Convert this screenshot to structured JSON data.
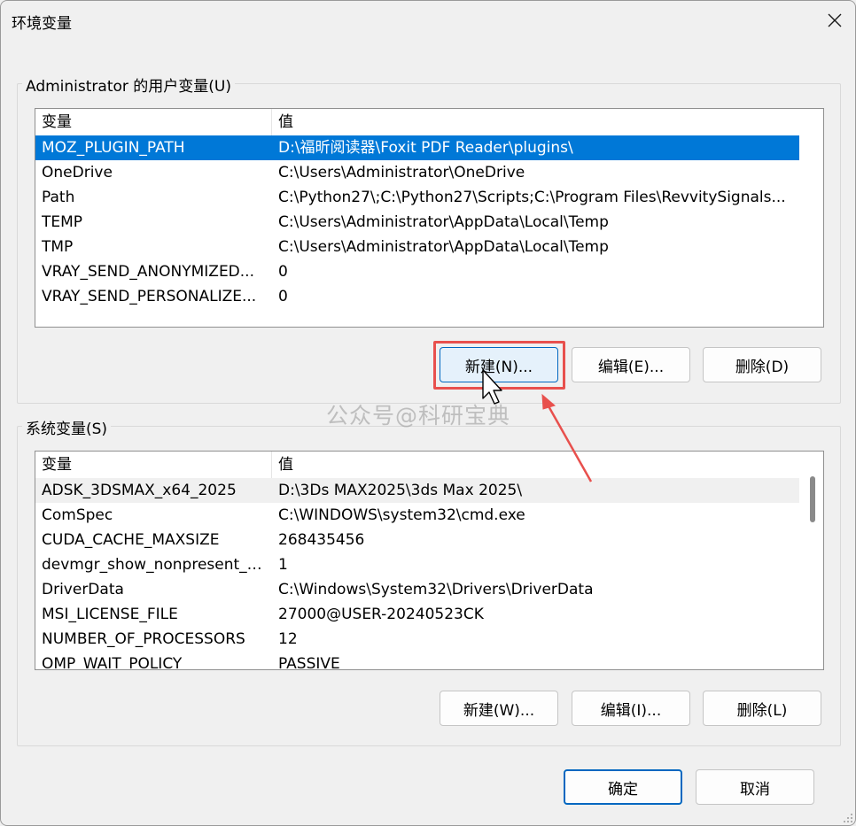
{
  "window": {
    "title": "环境变量"
  },
  "user_vars": {
    "legend": "Administrator 的用户变量(U)",
    "col_var": "变量",
    "col_val": "值",
    "rows": [
      {
        "name": "MOZ_PLUGIN_PATH",
        "value": "D:\\福昕阅读器\\Foxit PDF Reader\\plugins\\"
      },
      {
        "name": "OneDrive",
        "value": "C:\\Users\\Administrator\\OneDrive"
      },
      {
        "name": "Path",
        "value": "C:\\Python27\\;C:\\Python27\\Scripts;C:\\Program Files\\RevvitySignals..."
      },
      {
        "name": "TEMP",
        "value": "C:\\Users\\Administrator\\AppData\\Local\\Temp"
      },
      {
        "name": "TMP",
        "value": "C:\\Users\\Administrator\\AppData\\Local\\Temp"
      },
      {
        "name": "VRAY_SEND_ANONYMIZED...",
        "value": "0"
      },
      {
        "name": "VRAY_SEND_PERSONALIZE...",
        "value": "0"
      }
    ],
    "new_label": "新建(N)...",
    "edit_label": "编辑(E)...",
    "delete_label": "删除(D)"
  },
  "system_vars": {
    "legend": "系统变量(S)",
    "col_var": "变量",
    "col_val": "值",
    "rows": [
      {
        "name": "ADSK_3DSMAX_x64_2025",
        "value": "D:\\3Ds MAX2025\\3ds Max 2025\\"
      },
      {
        "name": "ComSpec",
        "value": "C:\\WINDOWS\\system32\\cmd.exe"
      },
      {
        "name": "CUDA_CACHE_MAXSIZE",
        "value": "268435456"
      },
      {
        "name": "devmgr_show_nonpresent_d...",
        "value": "1"
      },
      {
        "name": "DriverData",
        "value": "C:\\Windows\\System32\\Drivers\\DriverData"
      },
      {
        "name": "MSI_LICENSE_FILE",
        "value": "27000@USER-20240523CK"
      },
      {
        "name": "NUMBER_OF_PROCESSORS",
        "value": "12"
      },
      {
        "name": "OMP_WAIT_POLICY",
        "value": "PASSIVE"
      }
    ],
    "new_label": "新建(W)...",
    "edit_label": "编辑(I)...",
    "delete_label": "删除(L)"
  },
  "footer": {
    "ok_label": "确定",
    "cancel_label": "取消"
  },
  "watermark": "公众号@科研宝典",
  "colors": {
    "selection": "#0078d7",
    "annotation": "#e8504d",
    "accent": "#0067c0"
  },
  "icons": {
    "close": "close-icon",
    "cursor": "mouse-pointer-icon",
    "arrow": "annotation-arrow-icon"
  }
}
